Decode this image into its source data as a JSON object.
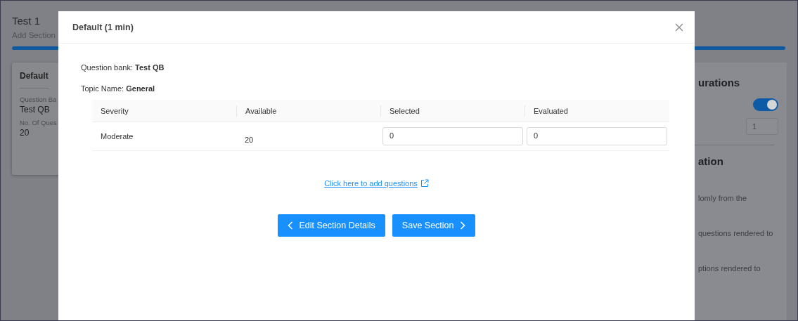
{
  "page": {
    "title": "Test 1",
    "subtitle": "Add Section",
    "progress": {
      "level": 1
    },
    "card": {
      "title": "Default",
      "fields": [
        {
          "label": "Question Ba",
          "value": "Test QB"
        },
        {
          "label": "No. Of Ques",
          "value": "20"
        }
      ]
    },
    "config": {
      "heading": "urations",
      "toggle": {
        "on": true
      },
      "input": "1",
      "heading_2": "ation",
      "lines": [
        "lomly from the",
        "questions rendered to",
        "ptions rendered to"
      ]
    }
  },
  "modal": {
    "title": "Default (1 min)",
    "question_bank": {
      "label": "Question bank:",
      "value": "Test QB"
    },
    "topic": {
      "label": "Topic Name:",
      "value": "General"
    },
    "table": {
      "columns": [
        "Severity",
        "Available",
        "Selected",
        "Evaluated"
      ],
      "rows": [
        {
          "severity": "Moderate",
          "available": "20",
          "selected": "0",
          "evaluated": "0"
        }
      ]
    },
    "link": "Click here to add questions",
    "buttons": [
      {
        "label": "Edit Section Details",
        "kind": "back"
      },
      {
        "label": "Save Section",
        "kind": "next"
      }
    ]
  }
}
